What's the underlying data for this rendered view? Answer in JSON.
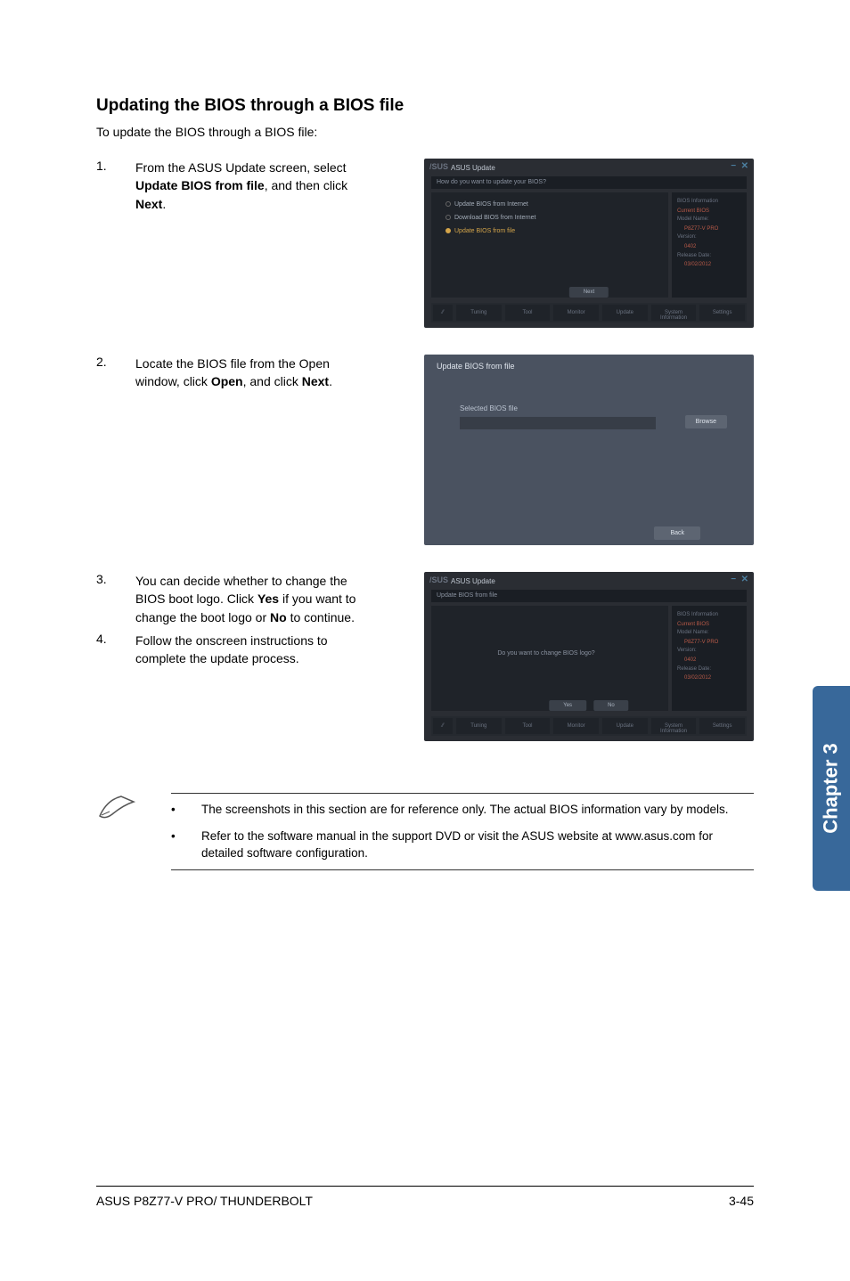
{
  "heading": "Updating the BIOS through a BIOS file",
  "intro": "To update the BIOS through a BIOS file:",
  "steps": {
    "s1": {
      "num": "1.",
      "t1": "From the ASUS Update screen, select ",
      "b1": "Update BIOS from file",
      "t2": ", and then click ",
      "b2": "Next",
      "t3": "."
    },
    "s2": {
      "num": "2.",
      "t1": "Locate the BIOS file from the Open window, click ",
      "b1": "Open",
      "t2": ", and click ",
      "b2": "Next",
      "t3": "."
    },
    "s3": {
      "num": "3.",
      "t1": "You can decide whether to change the BIOS boot logo. Click ",
      "b1": "Yes",
      "t2": " if you want to change the boot logo or ",
      "b2": "No",
      "t3": " to continue."
    },
    "s4": {
      "num": "4.",
      "txt": "Follow the onscreen instructions to complete the update process."
    }
  },
  "shot1": {
    "win": "ASUS Update",
    "header": "How do you want to update your BIOS?",
    "r1": "Update BIOS from Internet",
    "r2": "Download BIOS from Internet",
    "r3": "Update BIOS from file",
    "side_cur": "Current BIOS",
    "side_model": "Model Name:",
    "side_model_v": "P8Z77-V PRO",
    "side_ver": "Version:",
    "side_ver_v": "0402",
    "side_date": "Release Date:",
    "side_date_v": "03/02/2012",
    "side_info": "BIOS Information",
    "next": "Next",
    "f1": "Tuning",
    "f2": "Tool",
    "f3": "Monitor",
    "f4": "Update",
    "f5": "System Information",
    "f6": "Settings"
  },
  "shot2": {
    "title": "Update BIOS from file",
    "label": "Selected BIOS file",
    "browse": "Browse",
    "back": "Back"
  },
  "shot3": {
    "win": "ASUS Update",
    "header": "Update BIOS from file",
    "q": "Do you want to change BIOS logo?",
    "yes": "Yes",
    "no": "No"
  },
  "notes": {
    "n1": "The screenshots in this section are for reference only. The actual BIOS information vary by models.",
    "n2": "Refer to the software manual in the support DVD or visit the ASUS website at www.asus.com for detailed software configuration."
  },
  "sidetab": "Chapter 3",
  "footer": {
    "left": "ASUS P8Z77-V PRO/ THUNDERBOLT",
    "right": "3-45"
  }
}
